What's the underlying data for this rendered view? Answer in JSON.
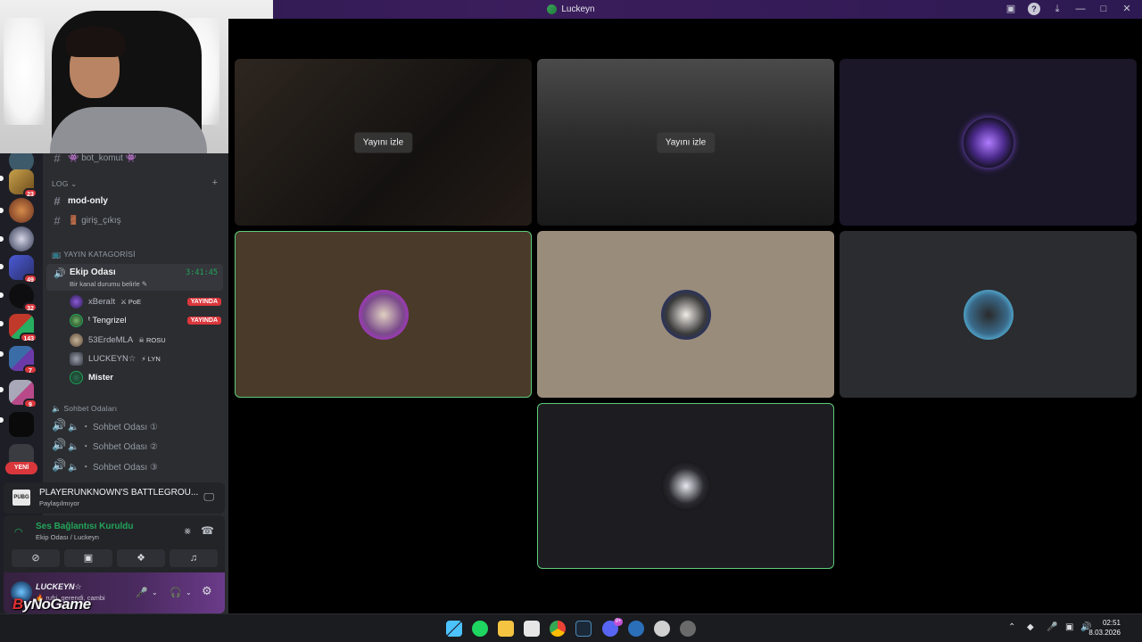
{
  "window": {
    "title": "Luckeyn"
  },
  "sidebar": {
    "top_channel": "👾 bot_komut 👾",
    "log_category": "LOG",
    "channels": [
      {
        "label": "mod-only"
      },
      {
        "label": "🚪 giriş_çıkış"
      }
    ],
    "stream_category": "📺 YAYIN KATAGORİSİ",
    "voice_channel": {
      "name": "Ekip Odası",
      "timer": "3:41:45",
      "status": "Bir kanal durumu belirle ✎"
    },
    "members": [
      {
        "name": "xBeraIt",
        "tag": "⚔ PoE",
        "live": "YAYINDA",
        "color": "#5b3c8a"
      },
      {
        "name": "ᵗ Tengrizel",
        "tag": "",
        "live": "YAYINDA",
        "color": "#3f6d3c"
      },
      {
        "name": "53ErdeMLA",
        "tag": "☠ ROSU",
        "live": "",
        "color": "#8a7a68"
      },
      {
        "name": "LUCKEYN☆",
        "tag": "⚡ LYN",
        "live": "",
        "color": "#555a66"
      },
      {
        "name": "Mister",
        "tag": "",
        "live": "",
        "color": "#2e6b4f"
      }
    ],
    "chat_category": "Sohbet Odaları",
    "chat_rooms": [
      {
        "label": "🔈 ・ Sohbet Odası ①"
      },
      {
        "label": "🔈 ・ Sohbet Odası ②"
      },
      {
        "label": "🔈 ・ Sohbet Odası ③"
      }
    ]
  },
  "rail": {
    "badges": [
      "23",
      "49",
      "32",
      "143",
      "7",
      "9"
    ],
    "new_label": "YENİ"
  },
  "activity": {
    "game_icon": "PUBG",
    "game": "PLAYERUNKNOWN'S BATTLEGROU...",
    "sub": "Paylaşılmıyor"
  },
  "voice_status": {
    "state": "Ses Bağlantısı Kuruldu",
    "where": "Ekip Odası / Luckeyn"
  },
  "user": {
    "name": "LUCKEYN☆",
    "status": "🔥 rufri, gerendi, cambi"
  },
  "watermark": {
    "b": "B",
    "rest": "yNoGame"
  },
  "stage": {
    "watch_label": "Yayını izle"
  },
  "taskbar": {
    "discord_badge": "9+",
    "time": "02:51",
    "date": "8.03.2026"
  },
  "colors": {
    "accent_green": "#23a55a",
    "live_red": "#da373c",
    "speaking_border": "#5ccc78"
  }
}
